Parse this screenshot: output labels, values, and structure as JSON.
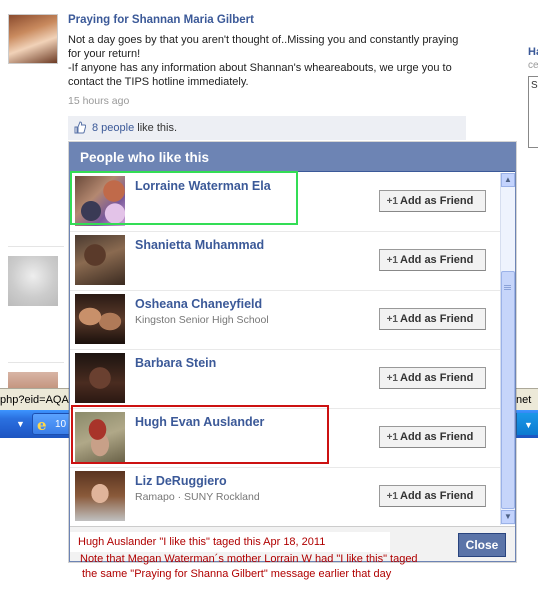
{
  "post": {
    "title": "Praying for Shannan Maria Gilbert",
    "body": "Not a day goes by that you aren't thought of..Missing you and constantly praying\nfor your return!\n-If anyone has any information about Shannan's wheareabouts, we urge you to\ncontact the TIPS hotline immediately.",
    "time": "15 hours ago",
    "likes_link": "8 people",
    "likes_suffix": " like this."
  },
  "right_fragment": {
    "heading": "Ha",
    "subtext": "ce",
    "box_text": "S"
  },
  "status_bar": {
    "left_text": "php?eid=AQA",
    "right_text": "net"
  },
  "taskbar": {
    "button_text": "10"
  },
  "dialog": {
    "title": "People who like this",
    "add_button_label": "Add as Friend",
    "add_button_icon": "+1",
    "close_label": "Close",
    "people": [
      {
        "name": "Lorraine Waterman Ela",
        "subtitle": ""
      },
      {
        "name": "Shanietta Muhammad",
        "subtitle": ""
      },
      {
        "name": "Osheana Chaneyfield",
        "subtitle": "Kingston Senior High School"
      },
      {
        "name": "Barbara Stein",
        "subtitle": ""
      },
      {
        "name": "Hugh Evan Auslander",
        "subtitle": ""
      },
      {
        "name": "Liz DeRuggiero",
        "subtitle": "Ramapo · SUNY Rockland"
      }
    ]
  },
  "annotations": {
    "line1": "Hugh Auslander  \"I like this\" taged  this  Apr 18, 2011",
    "line2": "Note that  Megan Waterman´s mother Lorrain W  had \"I like this\" taged",
    "line3": "the same \"Praying for Shanna Gilbert\" message earlier that day",
    "highlight_colors": {
      "green": "#33dd55",
      "red": "#cc1111"
    },
    "text_color": "#b00000"
  },
  "colors": {
    "facebook_blue": "#3b5998",
    "dialog_header": "#6d84b4"
  }
}
